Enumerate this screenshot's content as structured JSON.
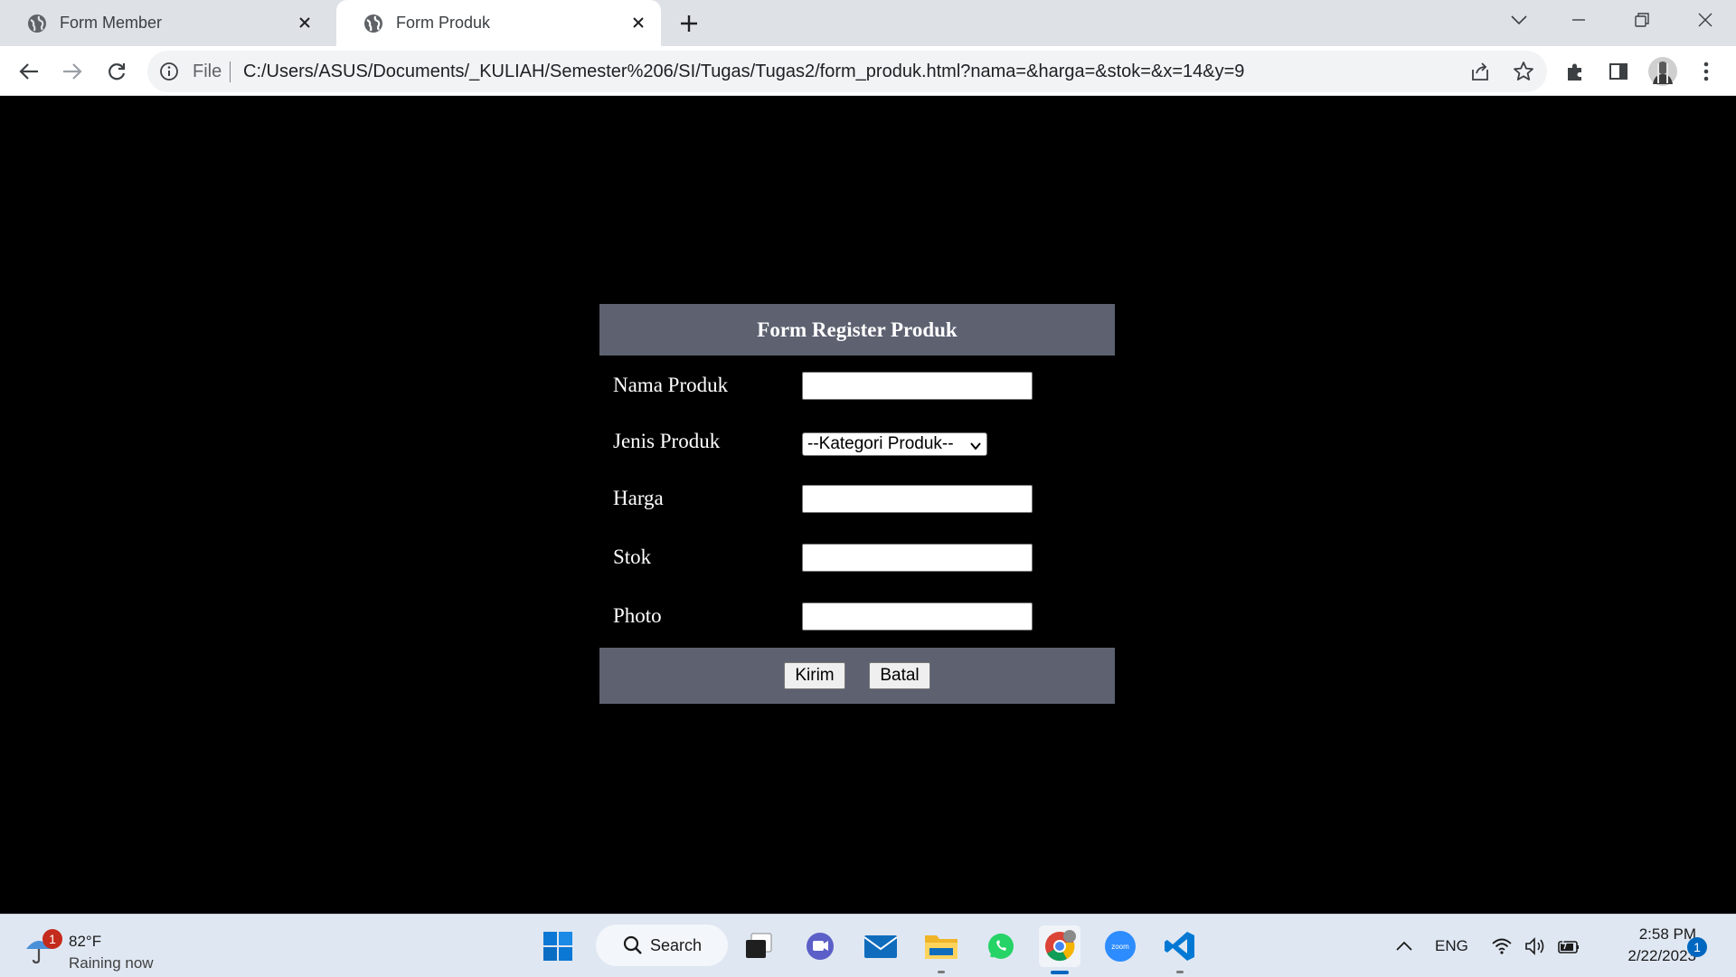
{
  "browser": {
    "tabs": [
      {
        "title": "Form Member",
        "active": false,
        "icon": "globe-icon"
      },
      {
        "title": "Form Produk",
        "active": true,
        "icon": "globe-icon"
      }
    ],
    "omnibox": {
      "scheme_label": "File",
      "url": "C:/Users/ASUS/Documents/_KULIAH/Semester%206/SI/Tugas/Tugas2/form_produk.html?nama=&harga=&stok=&x=14&y=9"
    }
  },
  "form": {
    "title": "Form Register Produk",
    "fields": {
      "nama": {
        "label": "Nama Produk",
        "value": ""
      },
      "jenis": {
        "label": "Jenis Produk",
        "selected": "--Kategori Produk--"
      },
      "harga": {
        "label": "Harga",
        "value": ""
      },
      "stok": {
        "label": "Stok",
        "value": ""
      },
      "photo": {
        "label": "Photo",
        "value": ""
      }
    },
    "buttons": {
      "submit": "Kirim",
      "cancel": "Batal"
    }
  },
  "taskbar": {
    "weather": {
      "badge": "1",
      "temp": "82°F",
      "condition": "Raining now"
    },
    "search_label": "Search",
    "language": "ENG",
    "time": "2:58 PM",
    "date": "2/22/2023",
    "notification_count": "1"
  },
  "colors": {
    "page_background": "#000000",
    "form_header": "#5d6170",
    "tabstrip": "#dee1e6",
    "taskbar": "#dfe7f2"
  }
}
